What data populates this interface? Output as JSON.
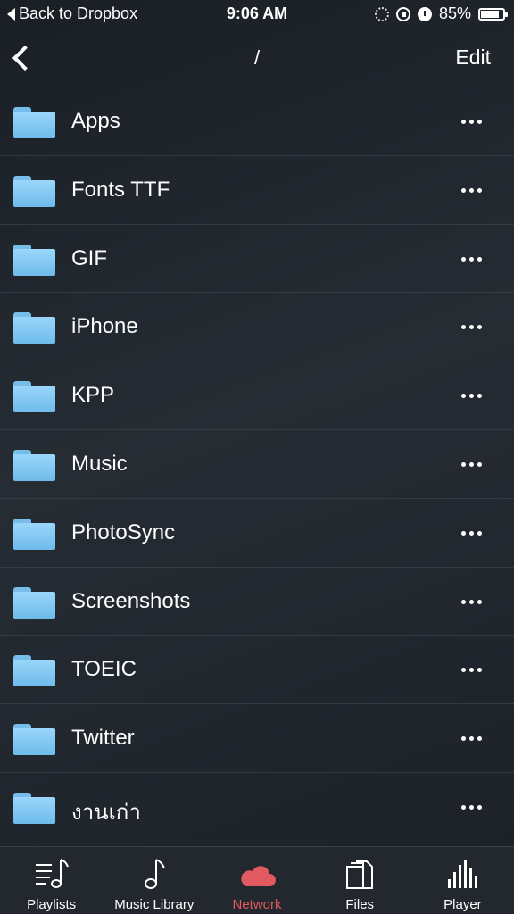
{
  "status_bar": {
    "back_text": "Back to Dropbox",
    "time": "9:06 AM",
    "battery_text": "85%",
    "battery_level": 0.85
  },
  "nav": {
    "title": "/",
    "edit_label": "Edit"
  },
  "files": [
    {
      "name": "Apps",
      "icon": "folder-icon"
    },
    {
      "name": "Fonts TTF",
      "icon": "folder-icon"
    },
    {
      "name": "GIF",
      "icon": "folder-icon"
    },
    {
      "name": "iPhone",
      "icon": "folder-icon"
    },
    {
      "name": "KPP",
      "icon": "folder-icon"
    },
    {
      "name": "Music",
      "icon": "folder-icon"
    },
    {
      "name": "PhotoSync",
      "icon": "folder-icon"
    },
    {
      "name": "Screenshots",
      "icon": "folder-icon"
    },
    {
      "name": "TOEIC",
      "icon": "folder-icon"
    },
    {
      "name": "Twitter",
      "icon": "folder-icon"
    },
    {
      "name": "งานเก่า",
      "icon": "folder-icon"
    }
  ],
  "tabs": [
    {
      "label": "Playlists",
      "icon": "playlists-icon",
      "active": false
    },
    {
      "label": "Music Library",
      "icon": "music-note-icon",
      "active": false
    },
    {
      "label": "Network",
      "icon": "cloud-icon",
      "active": true
    },
    {
      "label": "Files",
      "icon": "files-icon",
      "active": false
    },
    {
      "label": "Player",
      "icon": "equalizer-icon",
      "active": false
    }
  ],
  "colors": {
    "accent": "#e05a5f",
    "folder": "#8ccff8",
    "background": "#222830"
  }
}
